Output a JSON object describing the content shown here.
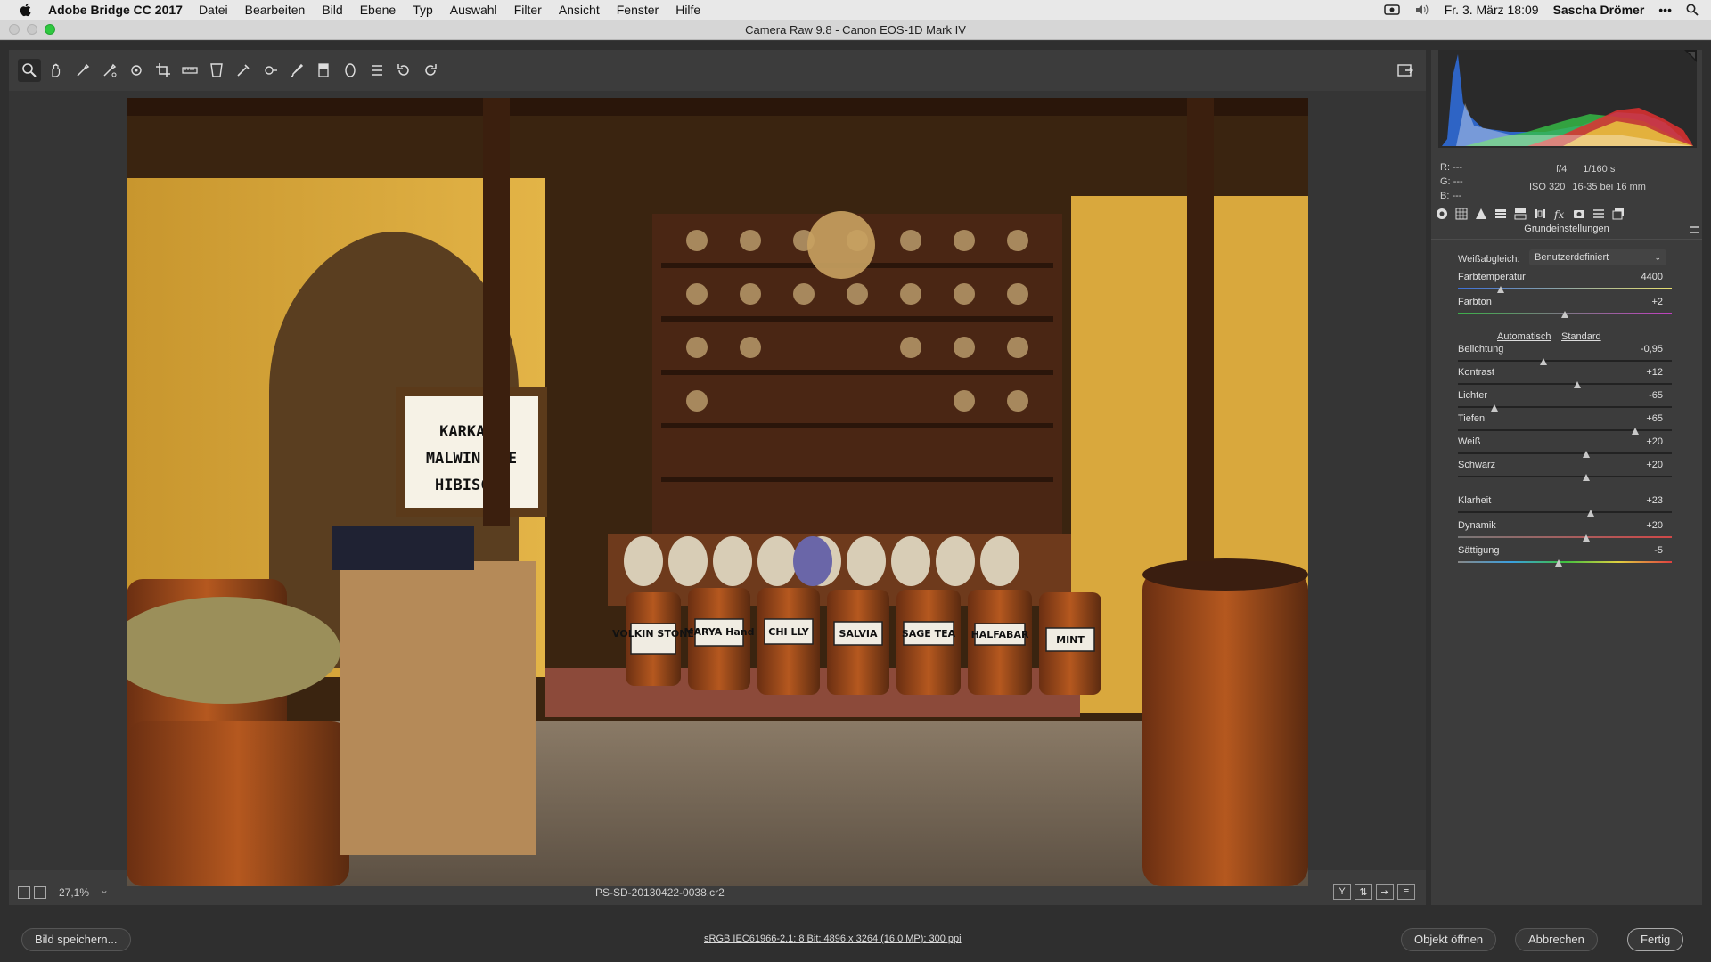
{
  "menubar": {
    "app_name": "Adobe Bridge CC 2017",
    "items": [
      "Datei",
      "Bearbeiten",
      "Bild",
      "Ebene",
      "Typ",
      "Auswahl",
      "Filter",
      "Ansicht",
      "Fenster",
      "Hilfe"
    ],
    "clock": "Fr. 3. März  18:09",
    "user": "Sascha Drömer"
  },
  "window": {
    "title": "Camera Raw 9.8  -  Canon EOS-1D Mark IV"
  },
  "toolbar": {
    "tools": [
      "zoom-tool-icon",
      "hand-tool-icon",
      "white-balance-tool-icon",
      "color-sampler-tool-icon",
      "targeted-adjustment-tool-icon",
      "crop-tool-icon",
      "straighten-tool-icon",
      "transform-tool-icon",
      "spot-removal-tool-icon",
      "red-eye-tool-icon",
      "adjustment-brush-icon",
      "graduated-filter-icon",
      "radial-filter-icon",
      "preferences-icon",
      "rotate-left-icon",
      "rotate-right-icon"
    ]
  },
  "image_text": {
    "sign_lines": [
      "KARKADE",
      "MALWIN TEE",
      "HIBISCUS"
    ],
    "barrel_labels": [
      "VOLKIN STONE",
      "MARYA Hand",
      "CHI LLY",
      "SALVIA",
      "SAGE TEA",
      "HALFABAR",
      "MINT"
    ]
  },
  "status": {
    "zoom": "27,1%",
    "filename": "PS-SD-20130422-0038.cr2"
  },
  "histogram_info": {
    "r_label": "R:",
    "r_value": "---",
    "g_label": "G:",
    "g_value": "---",
    "b_label": "B:",
    "b_value": "---",
    "aperture": "f/4",
    "shutter": "1/160 s",
    "iso": "ISO 320",
    "lens": "16-35 bei 16 mm"
  },
  "panel": {
    "title": "Grundeinstellungen",
    "wb_label": "Weißabgleich:",
    "wb_value": "Benutzerdefiniert",
    "auto_label": "Automatisch",
    "standard_label": "Standard",
    "sliders": [
      {
        "label": "Farbtemperatur",
        "value": "4400",
        "fraction": 0.2
      },
      {
        "label": "Farbton",
        "value": "+2",
        "fraction": 0.5
      },
      {
        "label": "Belichtung",
        "value": "-0,95",
        "fraction": 0.4
      },
      {
        "label": "Kontrast",
        "value": "+12",
        "fraction": 0.56
      },
      {
        "label": "Lichter",
        "value": "-65",
        "fraction": 0.17
      },
      {
        "label": "Tiefen",
        "value": "+65",
        "fraction": 0.83
      },
      {
        "label": "Weiß",
        "value": "+20",
        "fraction": 0.6
      },
      {
        "label": "Schwarz",
        "value": "+20",
        "fraction": 0.6
      },
      {
        "label": "Klarheit",
        "value": "+23",
        "fraction": 0.62
      },
      {
        "label": "Dynamik",
        "value": "+20",
        "fraction": 0.6
      },
      {
        "label": "Sättigung",
        "value": "-5",
        "fraction": 0.47
      }
    ]
  },
  "bottom": {
    "save_label": "Bild speichern...",
    "workflow_text": "sRGB IEC61966-2.1; 8 Bit; 4896 x 3264 (16,0 MP); 300 ppi",
    "open_label": "Objekt öffnen",
    "cancel_label": "Abbrechen",
    "done_label": "Fertig"
  }
}
